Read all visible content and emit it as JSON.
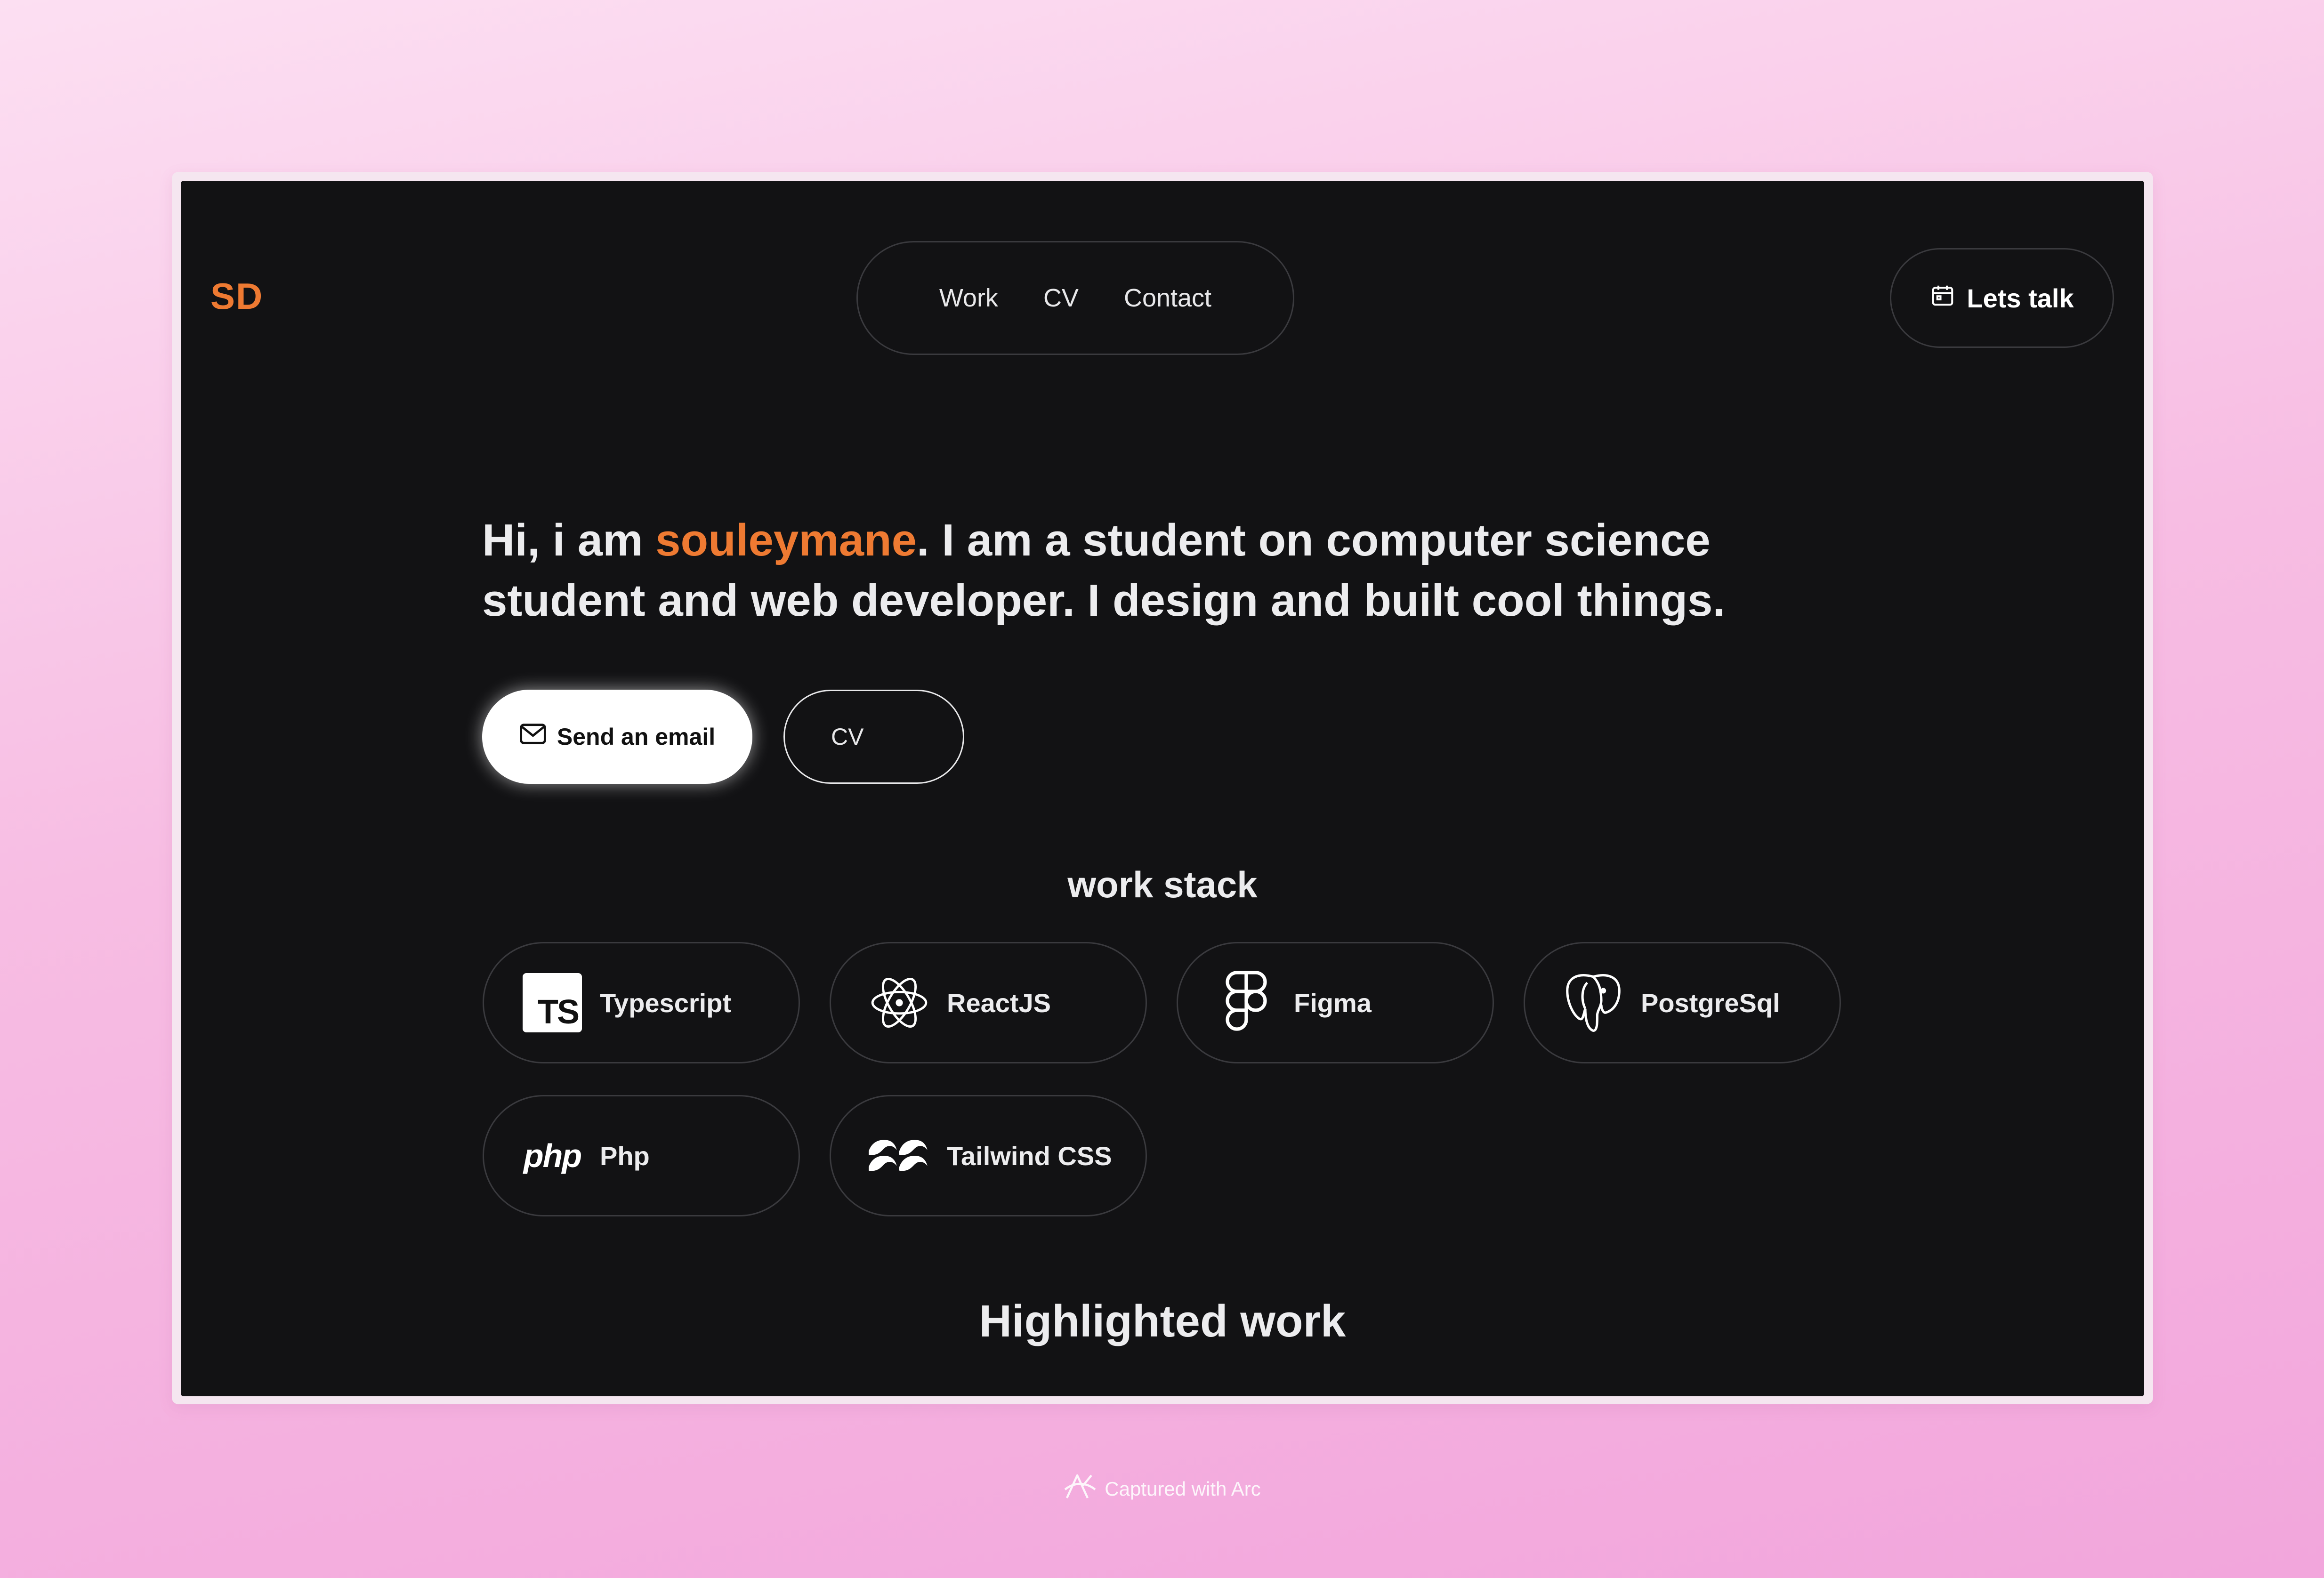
{
  "colors": {
    "accent": "#ee7a32",
    "screen_background": "#121214",
    "text": "#ececee",
    "border": "#3a3a3e",
    "page_gradient": [
      "#fcdff2",
      "#f2a6dc"
    ]
  },
  "header": {
    "logo": "SD",
    "nav": [
      {
        "label": "Work"
      },
      {
        "label": "CV"
      },
      {
        "label": "Contact"
      }
    ],
    "cta": {
      "label": "Lets talk",
      "icon": "calendar-icon"
    }
  },
  "hero": {
    "intro_prefix": "Hi, i am ",
    "name": "souleymane",
    "intro_suffix": ". I am a student on computer science student and web developer. I design and built cool things.",
    "primary_button": {
      "label": "Send an email",
      "icon": "mail-icon"
    },
    "secondary_button": {
      "label": "CV"
    }
  },
  "stack": {
    "title": "work stack",
    "items": [
      {
        "label": "Typescript",
        "icon": "typescript-icon",
        "glyph": "TS"
      },
      {
        "label": "ReactJS",
        "icon": "react-icon"
      },
      {
        "label": "Figma",
        "icon": "figma-icon"
      },
      {
        "label": "PostgreSql",
        "icon": "postgresql-icon"
      },
      {
        "label": "Php",
        "icon": "php-icon",
        "glyph": "php"
      },
      {
        "label": "Tailwind CSS",
        "icon": "tailwind-icon"
      }
    ]
  },
  "highlighted": {
    "title": "Highlighted work"
  },
  "footer": {
    "caption": "Captured with Arc",
    "icon": "arc-icon"
  }
}
